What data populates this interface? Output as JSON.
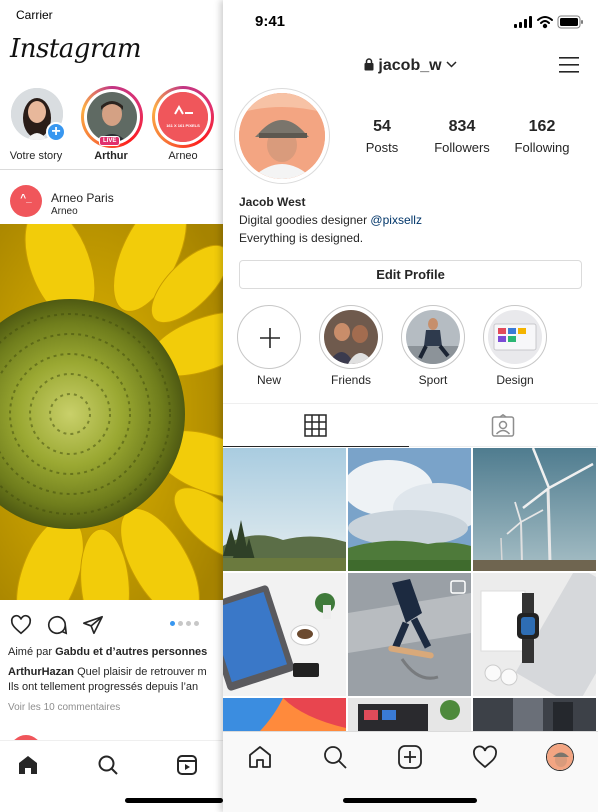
{
  "feed": {
    "carrier": "Carrier",
    "logo": "Instagram",
    "stories": [
      {
        "label": "Votre story",
        "avatar": "woman-avatar",
        "badge": "+"
      },
      {
        "label": "Arthur",
        "avatar": "man-avatar",
        "badge": "LIVE"
      },
      {
        "label": "Arneo",
        "avatar": "arneo-logo",
        "logo_text": "161 X 161 PIXELS"
      }
    ],
    "post": {
      "user": "Arneo Paris",
      "location": "Arneo",
      "avatar_text": "^_",
      "image": "sunflower",
      "carousel_pages": 4,
      "carousel_active": 1,
      "liked_by_prefix": "Aimé par ",
      "liked_by_names": "Gabdu et d’autres personnes",
      "caption_user": "ArthurHazan",
      "caption_text": " Quel plaisir de retrouver m",
      "caption_line2": "Ils ont tellement progressés depuis l’an",
      "view_comments": "Voir les 10 commentaires"
    },
    "tabbar": [
      "home-icon",
      "search-icon",
      "reels-icon"
    ]
  },
  "profile": {
    "time": "9:41",
    "username": "jacob_w",
    "stats": [
      {
        "value": "54",
        "label": "Posts"
      },
      {
        "value": "834",
        "label": "Followers"
      },
      {
        "value": "162",
        "label": "Following"
      }
    ],
    "name": "Jacob West",
    "bio_prefix": "Digital goodies designer ",
    "bio_handle": "@pixsellz",
    "bio_line2": "Everything is designed.",
    "edit_profile": "Edit Profile",
    "highlights": [
      {
        "label": "New"
      },
      {
        "label": "Friends"
      },
      {
        "label": "Sport"
      },
      {
        "label": "Design"
      }
    ],
    "grid_photos": [
      "forest-hills",
      "cloudy-valley",
      "wind-turbines",
      "laptop-coffee",
      "skateboarder",
      "smartwatch-laptop",
      "colorful-wallpaper",
      "laptop-desk",
      "dark-street"
    ],
    "tabbar": [
      "home-icon",
      "search-icon",
      "add-icon",
      "heart-icon",
      "profile-avatar"
    ]
  },
  "colors": {
    "accent_blue": "#3897f0",
    "live_pink": "#e1306c",
    "arneo_red": "#f0565b",
    "link": "#003569"
  }
}
